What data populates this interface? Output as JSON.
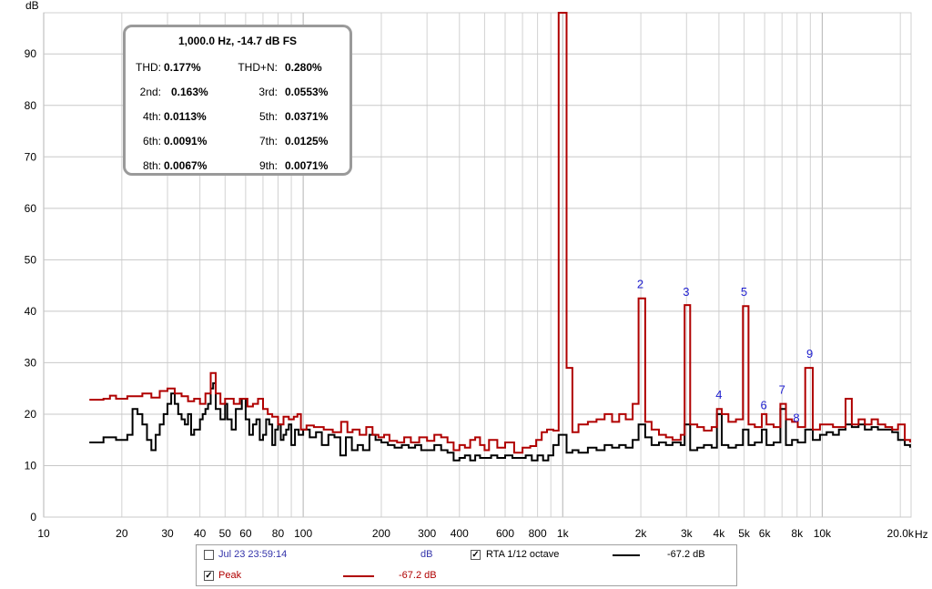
{
  "chart_data": {
    "type": "line",
    "xscale": "log",
    "xlim": [
      10,
      22000
    ],
    "ylim": [
      0,
      98
    ],
    "ylabel": "dB",
    "xlabel": "Hz",
    "grid": true,
    "x_ticks": [
      {
        "v": 10,
        "l": "10"
      },
      {
        "v": 20,
        "l": "20"
      },
      {
        "v": 30,
        "l": "30"
      },
      {
        "v": 40,
        "l": "40"
      },
      {
        "v": 50,
        "l": "50"
      },
      {
        "v": 60,
        "l": "60"
      },
      {
        "v": 80,
        "l": "80"
      },
      {
        "v": 100,
        "l": "100"
      },
      {
        "v": 200,
        "l": "200"
      },
      {
        "v": 300,
        "l": "300"
      },
      {
        "v": 400,
        "l": "400"
      },
      {
        "v": 600,
        "l": "600"
      },
      {
        "v": 800,
        "l": "800"
      },
      {
        "v": 1000,
        "l": "1k"
      },
      {
        "v": 2000,
        "l": "2k"
      },
      {
        "v": 3000,
        "l": "3k"
      },
      {
        "v": 4000,
        "l": "4k"
      },
      {
        "v": 5000,
        "l": "5k"
      },
      {
        "v": 6000,
        "l": "6k"
      },
      {
        "v": 8000,
        "l": "8k"
      },
      {
        "v": 10000,
        "l": "10k"
      },
      {
        "v": 20000,
        "l": "20.0k"
      }
    ],
    "y_ticks": [
      0,
      10,
      20,
      30,
      40,
      50,
      60,
      70,
      80,
      90
    ],
    "series": [
      {
        "name": "Peak",
        "color": "#b00000",
        "points": [
          [
            15,
            22.8
          ],
          [
            17,
            23
          ],
          [
            18,
            23.6
          ],
          [
            19,
            23
          ],
          [
            21,
            23.5
          ],
          [
            24,
            24
          ],
          [
            26,
            23.2
          ],
          [
            28,
            24.5
          ],
          [
            30,
            25
          ],
          [
            32,
            24
          ],
          [
            34,
            23.5
          ],
          [
            36,
            22.5
          ],
          [
            38,
            23
          ],
          [
            40,
            22
          ],
          [
            42,
            24
          ],
          [
            44,
            28
          ],
          [
            46,
            24
          ],
          [
            48,
            22
          ],
          [
            50,
            23
          ],
          [
            54,
            22
          ],
          [
            57,
            23
          ],
          [
            61,
            21.5
          ],
          [
            64,
            22
          ],
          [
            67,
            23
          ],
          [
            70,
            21
          ],
          [
            73,
            20
          ],
          [
            76,
            19.5
          ],
          [
            80,
            18
          ],
          [
            84,
            19.5
          ],
          [
            88,
            19
          ],
          [
            92,
            19.5
          ],
          [
            95,
            20
          ],
          [
            98,
            17
          ],
          [
            103,
            17.8
          ],
          [
            110,
            17.5
          ],
          [
            120,
            17
          ],
          [
            130,
            16.5
          ],
          [
            140,
            18.5
          ],
          [
            148,
            16.5
          ],
          [
            155,
            17
          ],
          [
            165,
            16
          ],
          [
            175,
            17.5
          ],
          [
            185,
            16
          ],
          [
            195,
            15.5
          ],
          [
            205,
            16
          ],
          [
            215,
            14.8
          ],
          [
            230,
            14.5
          ],
          [
            245,
            15.5
          ],
          [
            260,
            14.5
          ],
          [
            280,
            15.5
          ],
          [
            300,
            14.8
          ],
          [
            320,
            16
          ],
          [
            340,
            15.5
          ],
          [
            360,
            14.5
          ],
          [
            380,
            13
          ],
          [
            400,
            14
          ],
          [
            420,
            13.5
          ],
          [
            440,
            15
          ],
          [
            460,
            15.5
          ],
          [
            480,
            14
          ],
          [
            500,
            13
          ],
          [
            520,
            15
          ],
          [
            560,
            13.5
          ],
          [
            600,
            14.5
          ],
          [
            650,
            12.5
          ],
          [
            700,
            13.5
          ],
          [
            750,
            13.8
          ],
          [
            790,
            15
          ],
          [
            830,
            16.5
          ],
          [
            870,
            17
          ],
          [
            920,
            16.8
          ],
          [
            965,
            98
          ],
          [
            1035,
            29
          ],
          [
            1090,
            16.5
          ],
          [
            1150,
            18
          ],
          [
            1250,
            18.5
          ],
          [
            1350,
            19
          ],
          [
            1450,
            20
          ],
          [
            1550,
            18.5
          ],
          [
            1650,
            20
          ],
          [
            1750,
            19
          ],
          [
            1860,
            22
          ],
          [
            1960,
            42.5
          ],
          [
            2080,
            18.5
          ],
          [
            2200,
            17
          ],
          [
            2350,
            16
          ],
          [
            2500,
            15.5
          ],
          [
            2650,
            15
          ],
          [
            2850,
            16
          ],
          [
            2950,
            41.2
          ],
          [
            3100,
            18
          ],
          [
            3300,
            17.5
          ],
          [
            3500,
            16.8
          ],
          [
            3750,
            17.5
          ],
          [
            3930,
            21
          ],
          [
            4100,
            20
          ],
          [
            4350,
            18.5
          ],
          [
            4650,
            19
          ],
          [
            4950,
            41
          ],
          [
            5200,
            18
          ],
          [
            5500,
            17.5
          ],
          [
            5850,
            20
          ],
          [
            6100,
            18
          ],
          [
            6500,
            17.5
          ],
          [
            6900,
            22
          ],
          [
            7250,
            19
          ],
          [
            7650,
            18.5
          ],
          [
            8050,
            17.5
          ],
          [
            8600,
            29
          ],
          [
            9200,
            17
          ],
          [
            9800,
            18
          ],
          [
            10400,
            18
          ],
          [
            11000,
            17.5
          ],
          [
            11600,
            17.5
          ],
          [
            12300,
            23
          ],
          [
            13000,
            18
          ],
          [
            13800,
            19
          ],
          [
            14600,
            18
          ],
          [
            15500,
            19
          ],
          [
            16400,
            18
          ],
          [
            17500,
            17.5
          ],
          [
            18600,
            17
          ],
          [
            19600,
            18
          ],
          [
            20800,
            15
          ],
          [
            21800,
            14.5
          ]
        ]
      },
      {
        "name": "RTA 1/12 octave",
        "color": "#000000",
        "points": [
          [
            15,
            14.5
          ],
          [
            17,
            15.5
          ],
          [
            19,
            15
          ],
          [
            21,
            16
          ],
          [
            22,
            21
          ],
          [
            23,
            20
          ],
          [
            24,
            18
          ],
          [
            25,
            15
          ],
          [
            26,
            13
          ],
          [
            27,
            16
          ],
          [
            28,
            18
          ],
          [
            29,
            20
          ],
          [
            30,
            22
          ],
          [
            31,
            24
          ],
          [
            32,
            22
          ],
          [
            33,
            20
          ],
          [
            34,
            19
          ],
          [
            35,
            18
          ],
          [
            36,
            20
          ],
          [
            37,
            16
          ],
          [
            38,
            17
          ],
          [
            40,
            19
          ],
          [
            41,
            20
          ],
          [
            42,
            21
          ],
          [
            43,
            22
          ],
          [
            44,
            25
          ],
          [
            45,
            26
          ],
          [
            46,
            21
          ],
          [
            48,
            19
          ],
          [
            50,
            22
          ],
          [
            51,
            19
          ],
          [
            53,
            17
          ],
          [
            55,
            21
          ],
          [
            58,
            23
          ],
          [
            60,
            19
          ],
          [
            62,
            16
          ],
          [
            64,
            18
          ],
          [
            66,
            19
          ],
          [
            68,
            15
          ],
          [
            70,
            16
          ],
          [
            72,
            19
          ],
          [
            74,
            18
          ],
          [
            76,
            14
          ],
          [
            78,
            17
          ],
          [
            80,
            18
          ],
          [
            82,
            15
          ],
          [
            84,
            16
          ],
          [
            86,
            17
          ],
          [
            88,
            18
          ],
          [
            90,
            14
          ],
          [
            93,
            17
          ],
          [
            96,
            16
          ],
          [
            100,
            17
          ],
          [
            106,
            15.5
          ],
          [
            112,
            16.5
          ],
          [
            118,
            14
          ],
          [
            125,
            16
          ],
          [
            132,
            15.5
          ],
          [
            139,
            12
          ],
          [
            146,
            15.5
          ],
          [
            154,
            13
          ],
          [
            162,
            14
          ],
          [
            170,
            13
          ],
          [
            180,
            16
          ],
          [
            190,
            15
          ],
          [
            200,
            14.5
          ],
          [
            212,
            14
          ],
          [
            225,
            13.5
          ],
          [
            240,
            14
          ],
          [
            255,
            13.5
          ],
          [
            270,
            14
          ],
          [
            285,
            13
          ],
          [
            300,
            13
          ],
          [
            320,
            14
          ],
          [
            340,
            13
          ],
          [
            360,
            12.5
          ],
          [
            380,
            11
          ],
          [
            400,
            11.5
          ],
          [
            420,
            12
          ],
          [
            440,
            11
          ],
          [
            460,
            12
          ],
          [
            480,
            11.5
          ],
          [
            500,
            11.5
          ],
          [
            530,
            12
          ],
          [
            560,
            11.5
          ],
          [
            600,
            12
          ],
          [
            640,
            11.5
          ],
          [
            680,
            11.5
          ],
          [
            720,
            12
          ],
          [
            760,
            11
          ],
          [
            800,
            12
          ],
          [
            840,
            11
          ],
          [
            880,
            12
          ],
          [
            920,
            14
          ],
          [
            965,
            16
          ],
          [
            1035,
            12.5
          ],
          [
            1090,
            13
          ],
          [
            1150,
            12.5
          ],
          [
            1250,
            13.5
          ],
          [
            1350,
            13
          ],
          [
            1450,
            14
          ],
          [
            1550,
            13.5
          ],
          [
            1650,
            14
          ],
          [
            1750,
            13.5
          ],
          [
            1860,
            15
          ],
          [
            1960,
            18
          ],
          [
            2080,
            15.5
          ],
          [
            2200,
            14
          ],
          [
            2350,
            14.5
          ],
          [
            2500,
            14
          ],
          [
            2650,
            14.5
          ],
          [
            2850,
            14
          ],
          [
            2950,
            18
          ],
          [
            3100,
            13
          ],
          [
            3300,
            13.5
          ],
          [
            3500,
            14
          ],
          [
            3750,
            13.5
          ],
          [
            3930,
            20
          ],
          [
            4100,
            14
          ],
          [
            4350,
            13.5
          ],
          [
            4650,
            14
          ],
          [
            4950,
            17
          ],
          [
            5200,
            14
          ],
          [
            5500,
            14.5
          ],
          [
            5850,
            17
          ],
          [
            6100,
            14
          ],
          [
            6500,
            14.5
          ],
          [
            6900,
            21
          ],
          [
            7250,
            14
          ],
          [
            7650,
            15
          ],
          [
            8050,
            14.5
          ],
          [
            8600,
            17
          ],
          [
            9200,
            15
          ],
          [
            9800,
            16
          ],
          [
            10400,
            16.5
          ],
          [
            11000,
            16
          ],
          [
            11600,
            17
          ],
          [
            12300,
            18
          ],
          [
            13000,
            17.5
          ],
          [
            13800,
            18
          ],
          [
            14600,
            17
          ],
          [
            15500,
            17.5
          ],
          [
            16400,
            17
          ],
          [
            17500,
            17
          ],
          [
            18600,
            16.5
          ],
          [
            19600,
            15
          ],
          [
            20800,
            14
          ],
          [
            21800,
            13.5
          ]
        ]
      }
    ],
    "harmonic_labels": [
      {
        "text": "2",
        "f": 1990,
        "db": 44.5
      },
      {
        "text": "3",
        "f": 2990,
        "db": 43
      },
      {
        "text": "4",
        "f": 4000,
        "db": 23
      },
      {
        "text": "5",
        "f": 5000,
        "db": 43
      },
      {
        "text": "6",
        "f": 5950,
        "db": 21
      },
      {
        "text": "7",
        "f": 7000,
        "db": 24
      },
      {
        "text": "8",
        "f": 7950,
        "db": 18.5
      },
      {
        "text": "9",
        "f": 8950,
        "db": 31
      }
    ],
    "annotation_color": "#1f1fcf"
  },
  "stats": {
    "title": "1,000.0 Hz, -14.7 dB FS",
    "rows": [
      {
        "l1": "THD:",
        "v1": "0.177%",
        "l2": "THD+N:",
        "v2": "0.280%"
      },
      {
        "l1": "2nd:",
        "v1": "0.163%",
        "l2": "3rd:",
        "v2": "0.0553%"
      },
      {
        "l1": "4th:",
        "v1": "0.0113%",
        "l2": "5th:",
        "v2": "0.0371%"
      },
      {
        "l1": "6th:",
        "v1": "0.0091%",
        "l2": "7th:",
        "v2": "0.0125%"
      },
      {
        "l1": "8th:",
        "v1": "0.0067%",
        "l2": "9th:",
        "v2": "0.0071%"
      }
    ]
  },
  "legend": {
    "item1": {
      "label": "Jul 23 23:59:14",
      "checked": false,
      "unit": "dB",
      "color": "#3333aa"
    },
    "item2": {
      "label": "RTA 1/12 octave",
      "checked": true,
      "value": "-67.2 dB",
      "color": "#000000"
    },
    "item3": {
      "label": "Peak",
      "checked": true,
      "value": "-67.2 dB",
      "color": "#b00000"
    }
  }
}
